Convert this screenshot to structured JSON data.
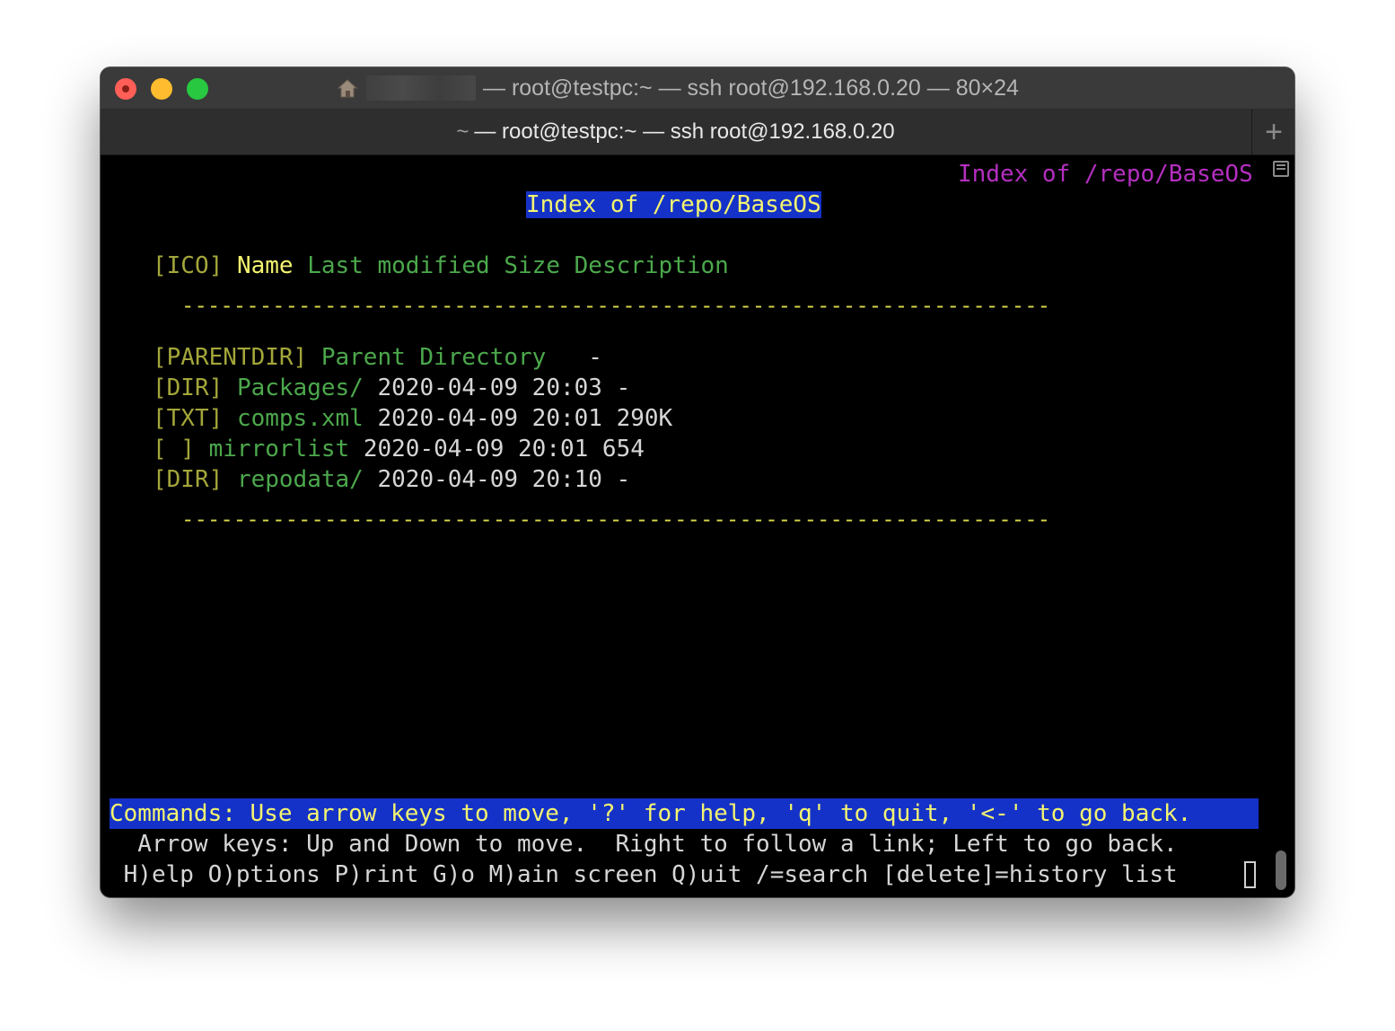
{
  "window": {
    "title_suffix": "— root@testpc:~ — ssh root@192.168.0.20 — 80×24",
    "tab": {
      "prefix": "~",
      "label": "— root@testpc:~ — ssh root@192.168.0.20"
    },
    "new_tab_label": "+"
  },
  "terminal": {
    "top_right_title": "Index of /repo/BaseOS",
    "heading": "Index of /repo/BaseOS",
    "columns": {
      "ico": "[ICO]",
      "name": "Name",
      "rest": "Last modified Size Description"
    },
    "separator": "-------------------------------------------------------------------",
    "entries": [
      {
        "icon": "[PARENTDIR]",
        "name": "Parent Directory",
        "meta": "   -"
      },
      {
        "icon": "[DIR]",
        "name": "Packages/",
        "meta": "2020-04-09 20:03 -"
      },
      {
        "icon": "[TXT]",
        "name": "comps.xml",
        "meta": "2020-04-09 20:01 290K"
      },
      {
        "icon": "[ ]",
        "name": "mirrorlist",
        "meta": "2020-04-09 20:01 654"
      },
      {
        "icon": "[DIR]",
        "name": "repodata/",
        "meta": "2020-04-09 20:10 -"
      }
    ],
    "commands": "Commands: Use arrow keys to move, '?' for help, 'q' to quit, '<-' to go back.",
    "help_line1": "  Arrow keys: Up and Down to move.  Right to follow a link; Left to go back.",
    "help_line2": " H)elp O)ptions P)rint G)o M)ain screen Q)uit /=search [delete]=history list"
  },
  "colors": {
    "highlight_bg": "#1432c8",
    "link_green": "#4ca84c",
    "title_magenta": "#b42fc0",
    "heading_yellow": "#f4f470"
  },
  "icons": [
    "home-icon",
    "close-button",
    "minimize-button",
    "zoom-button",
    "scroll-toggle-icon"
  ]
}
